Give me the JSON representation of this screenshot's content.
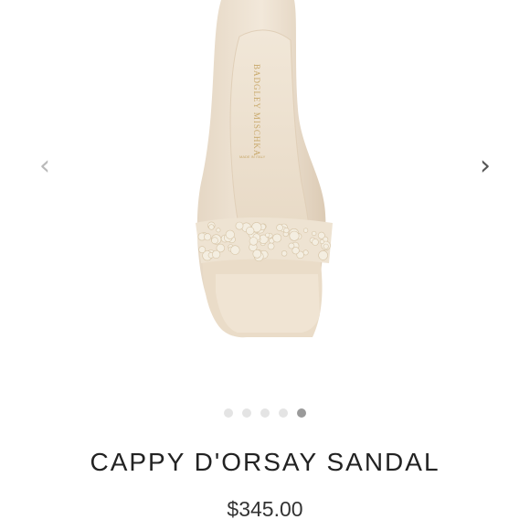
{
  "gallery": {
    "prev_icon": "chevron-left-icon",
    "next_icon": "chevron-right-icon",
    "prev_glyph": "‹",
    "next_glyph": "›",
    "slide_count": 5,
    "active_slide": 5
  },
  "product": {
    "name": "CAPPY D'ORSAY SANDAL",
    "price": "$345.00",
    "insole_brand": "BADGLEY MISCHKA"
  },
  "colors": {
    "satin": "#ede1d1",
    "pearl": "#f4eee1",
    "active_dot": "#9a9a9a",
    "inactive_dot": "#e4e4e4"
  }
}
